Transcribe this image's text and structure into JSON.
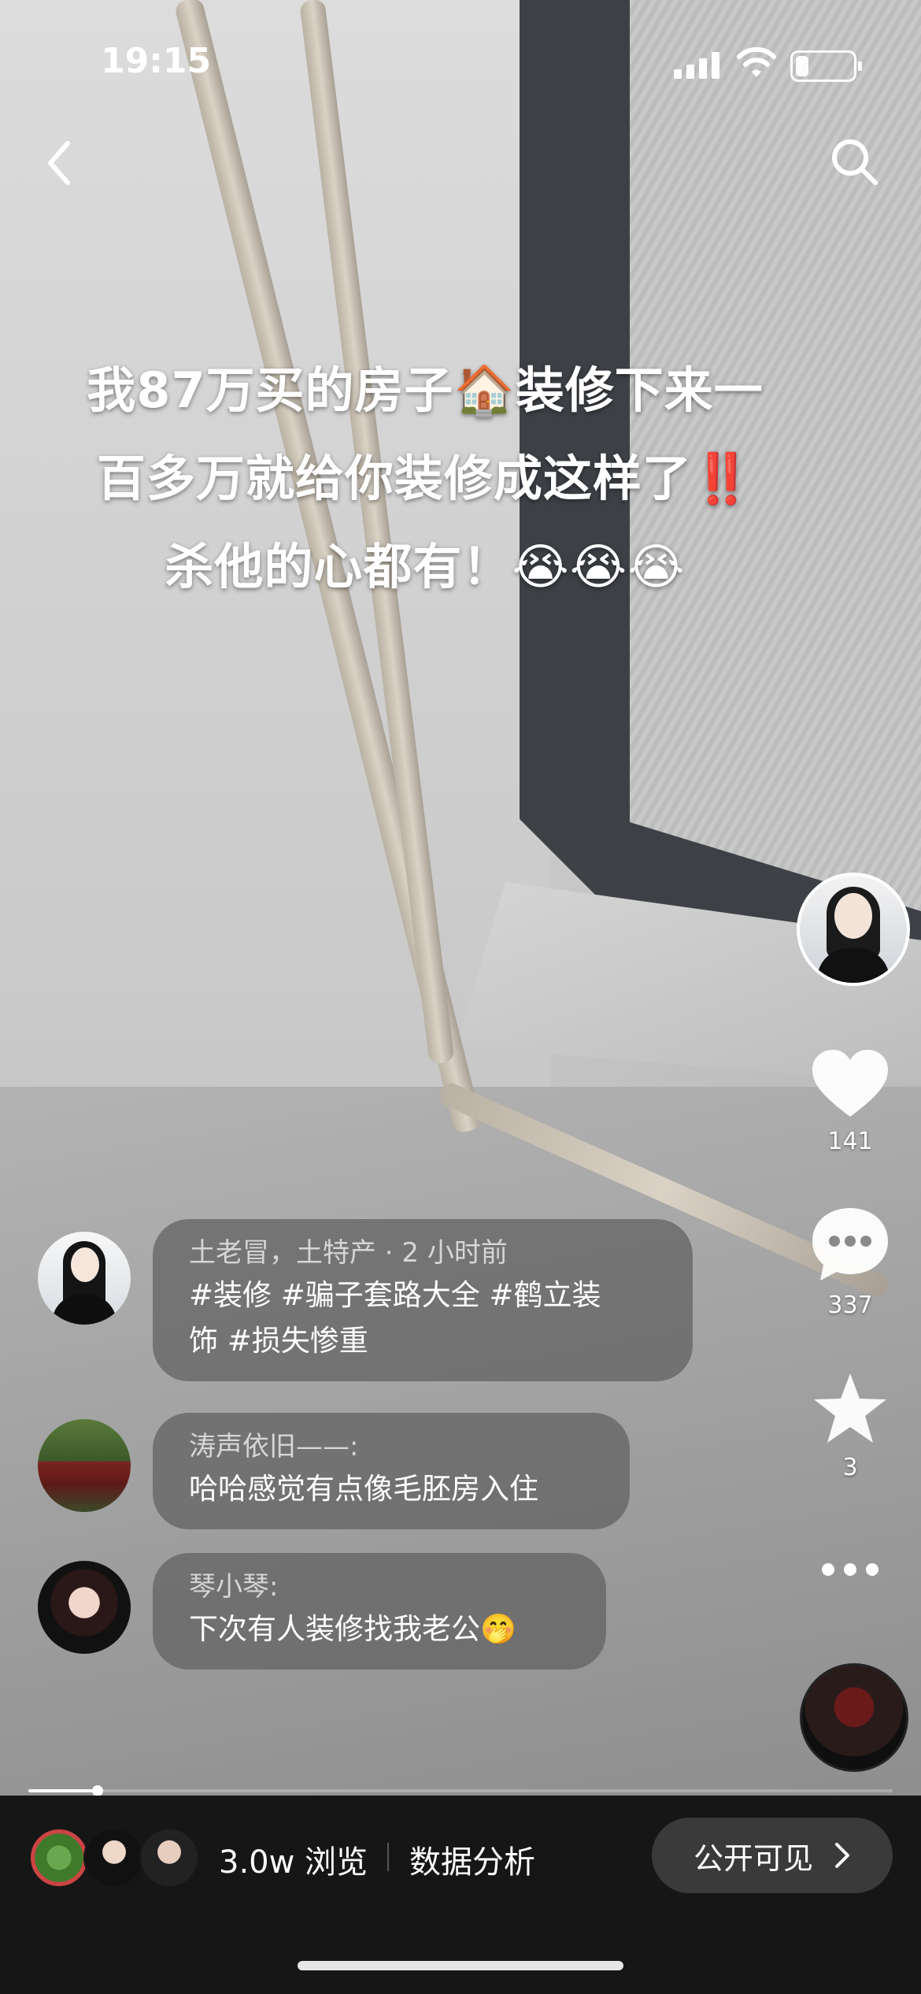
{
  "status_bar": {
    "time": "19:15",
    "battery_level": 0.25
  },
  "nav": {
    "back_icon": "chevron-left-icon",
    "search_icon": "search-icon"
  },
  "caption": {
    "line1": "我87万买的房子🏠装修下来一",
    "line2": "百多万就给你装修成这样了‼️",
    "line3": "杀他的心都有！😭😭😭"
  },
  "sidebar": {
    "like_count": "141",
    "comment_count": "337",
    "favorite_count": "3",
    "icons": [
      "heart-icon",
      "comment-icon",
      "star-icon",
      "more-icon",
      "music-disc-icon"
    ]
  },
  "comments": [
    {
      "name": "土老冒，土特产 · 2 小时前",
      "text_line1": "#装修 #骗子套路大全  #鹤立装",
      "text_line2": "饰 #损失惨重"
    },
    {
      "name": "涛声依旧——:",
      "text_line1": "哈哈感觉有点像毛胚房入住"
    },
    {
      "name": "琴小琴:",
      "text_line1": "下次有人装修找我老公🤭"
    }
  ],
  "video_progress": 0.08,
  "bottom_bar": {
    "views": "3.0w 浏览",
    "analysis": "数据分析",
    "visibility": "公开可见"
  }
}
